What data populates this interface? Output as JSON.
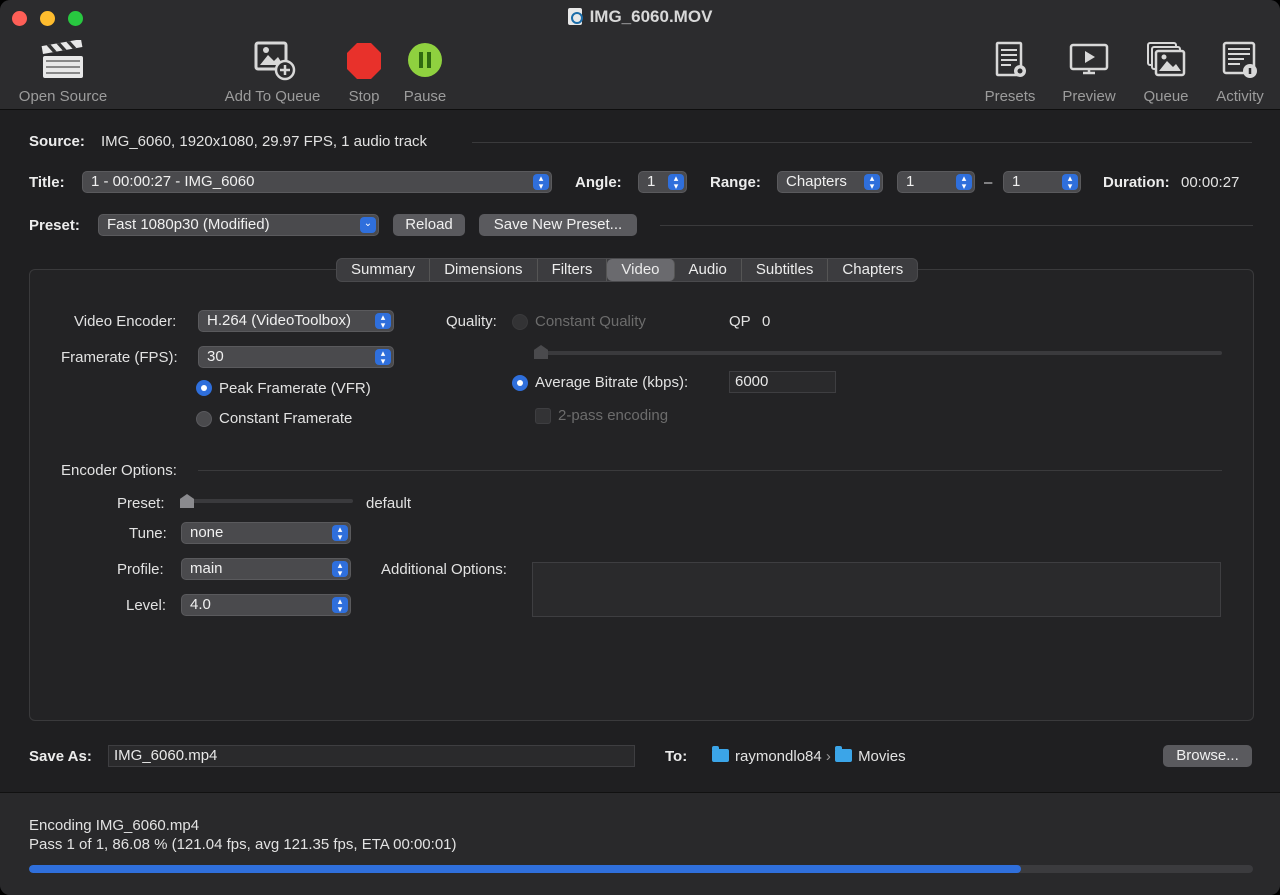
{
  "window": {
    "title": "IMG_6060.MOV"
  },
  "toolbar": {
    "open_source": "Open Source",
    "add_to_queue": "Add To Queue",
    "stop": "Stop",
    "pause": "Pause",
    "presets": "Presets",
    "preview": "Preview",
    "queue": "Queue",
    "activity": "Activity"
  },
  "source": {
    "label": "Source:",
    "value": "IMG_6060, 1920x1080, 29.97 FPS, 1 audio track"
  },
  "title_row": {
    "title_label": "Title:",
    "title_value": "1 - 00:00:27 - IMG_6060",
    "angle_label": "Angle:",
    "angle_value": "1",
    "range_label": "Range:",
    "range_value": "Chapters",
    "range_start": "1",
    "range_dash": "–",
    "range_end": "1",
    "duration_label": "Duration:",
    "duration_value": "00:00:27"
  },
  "preset_row": {
    "label": "Preset:",
    "value": "Fast 1080p30 (Modified)",
    "reload": "Reload",
    "save_new": "Save New Preset..."
  },
  "tabs": [
    {
      "label": "Summary"
    },
    {
      "label": "Dimensions"
    },
    {
      "label": "Filters"
    },
    {
      "label": "Video"
    },
    {
      "label": "Audio"
    },
    {
      "label": "Subtitles"
    },
    {
      "label": "Chapters"
    }
  ],
  "video": {
    "encoder_label": "Video Encoder:",
    "encoder_value": "H.264 (VideoToolbox)",
    "framerate_label": "Framerate (FPS):",
    "framerate_value": "30",
    "peak_framerate": "Peak Framerate (VFR)",
    "constant_framerate": "Constant Framerate",
    "quality_label": "Quality:",
    "constant_quality": "Constant Quality",
    "qp_label": "QP",
    "qp_value": "0",
    "avg_bitrate_label": "Average Bitrate (kbps):",
    "avg_bitrate_value": "6000",
    "two_pass": "2-pass encoding"
  },
  "encoder_options": {
    "title": "Encoder Options:",
    "preset_label": "Preset:",
    "preset_value": "default",
    "tune_label": "Tune:",
    "tune_value": "none",
    "profile_label": "Profile:",
    "profile_value": "main",
    "level_label": "Level:",
    "level_value": "4.0",
    "additional_label": "Additional Options:"
  },
  "save": {
    "label": "Save As:",
    "value": "IMG_6060.mp4",
    "to_label": "To:",
    "path_user": "raymondlo84",
    "path_sep": "›",
    "path_folder": "Movies",
    "browse": "Browse..."
  },
  "status": {
    "line1": "Encoding IMG_6060.mp4",
    "line2": "Pass 1 of 1, 86.08 % (121.04 fps, avg 121.35 fps, ETA 00:00:01)",
    "progress": 0.8108
  },
  "colors": {
    "accent": "#2f6fdc",
    "stop_red": "#e8312b",
    "pause_green": "#8fd13f",
    "close": "#fe5f57",
    "minimize": "#febc2e",
    "zoom": "#28c840"
  }
}
